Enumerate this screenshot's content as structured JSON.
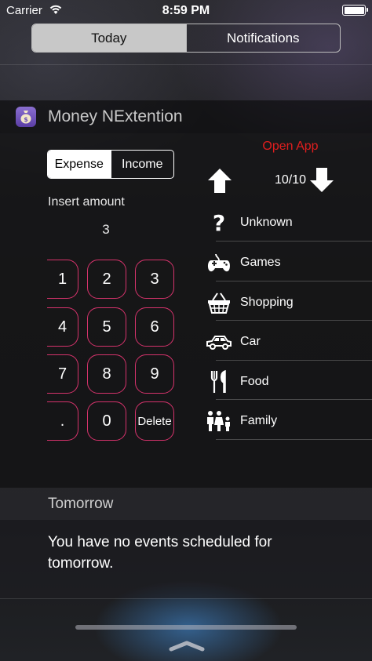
{
  "status_bar": {
    "carrier": "Carrier",
    "time": "8:59 PM",
    "wifi_icon": "wifi-icon",
    "battery_icon": "battery-icon"
  },
  "top_tabs": {
    "today": "Today",
    "notifications": "Notifications"
  },
  "widget": {
    "app_icon": "money-bag-icon",
    "title": "Money NExtention",
    "type_toggle": {
      "expense": "Expense",
      "income": "Income",
      "selected": "Expense"
    },
    "insert_label": "Insert amount",
    "amount": "3",
    "keypad": [
      [
        "1",
        "2",
        "3"
      ],
      [
        "4",
        "5",
        "6"
      ],
      [
        "7",
        "8",
        "9"
      ],
      [
        ".",
        "0",
        "Delete"
      ]
    ],
    "open_app": "Open App",
    "counter": "10/10",
    "accent_color": "#d6336c",
    "link_color": "#e01e1e",
    "categories": [
      {
        "label": "Unknown",
        "icon": "question-mark-icon"
      },
      {
        "label": "Games",
        "icon": "gamepad-icon"
      },
      {
        "label": "Shopping",
        "icon": "shopping-basket-icon"
      },
      {
        "label": "Car",
        "icon": "car-icon"
      },
      {
        "label": "Food",
        "icon": "fork-knife-icon"
      },
      {
        "label": "Family",
        "icon": "family-icon"
      }
    ]
  },
  "tomorrow": {
    "title": "Tomorrow",
    "message": "You have no events scheduled for tomorrow."
  }
}
